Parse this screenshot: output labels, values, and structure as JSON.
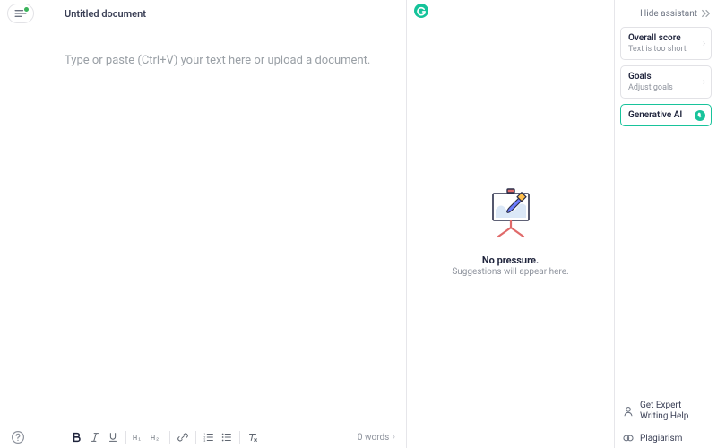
{
  "editor": {
    "doc_title": "Untitled document",
    "placeholder_pre": "Type or paste (Ctrl+V) your text here or ",
    "placeholder_upload": "upload",
    "placeholder_post": " a document.",
    "word_count": "0 words"
  },
  "suggestions": {
    "headline": "No pressure.",
    "subline": "Suggestions will appear here."
  },
  "sidebar": {
    "hide_label": "Hide assistant",
    "cards": {
      "score": {
        "title": "Overall score",
        "sub": "Text is too short"
      },
      "goals": {
        "title": "Goals",
        "sub": "Adjust goals"
      },
      "genai": {
        "title": "Generative AI"
      }
    },
    "expert_line1": "Get Expert",
    "expert_line2": "Writing Help",
    "plagiarism": "Plagiarism"
  }
}
